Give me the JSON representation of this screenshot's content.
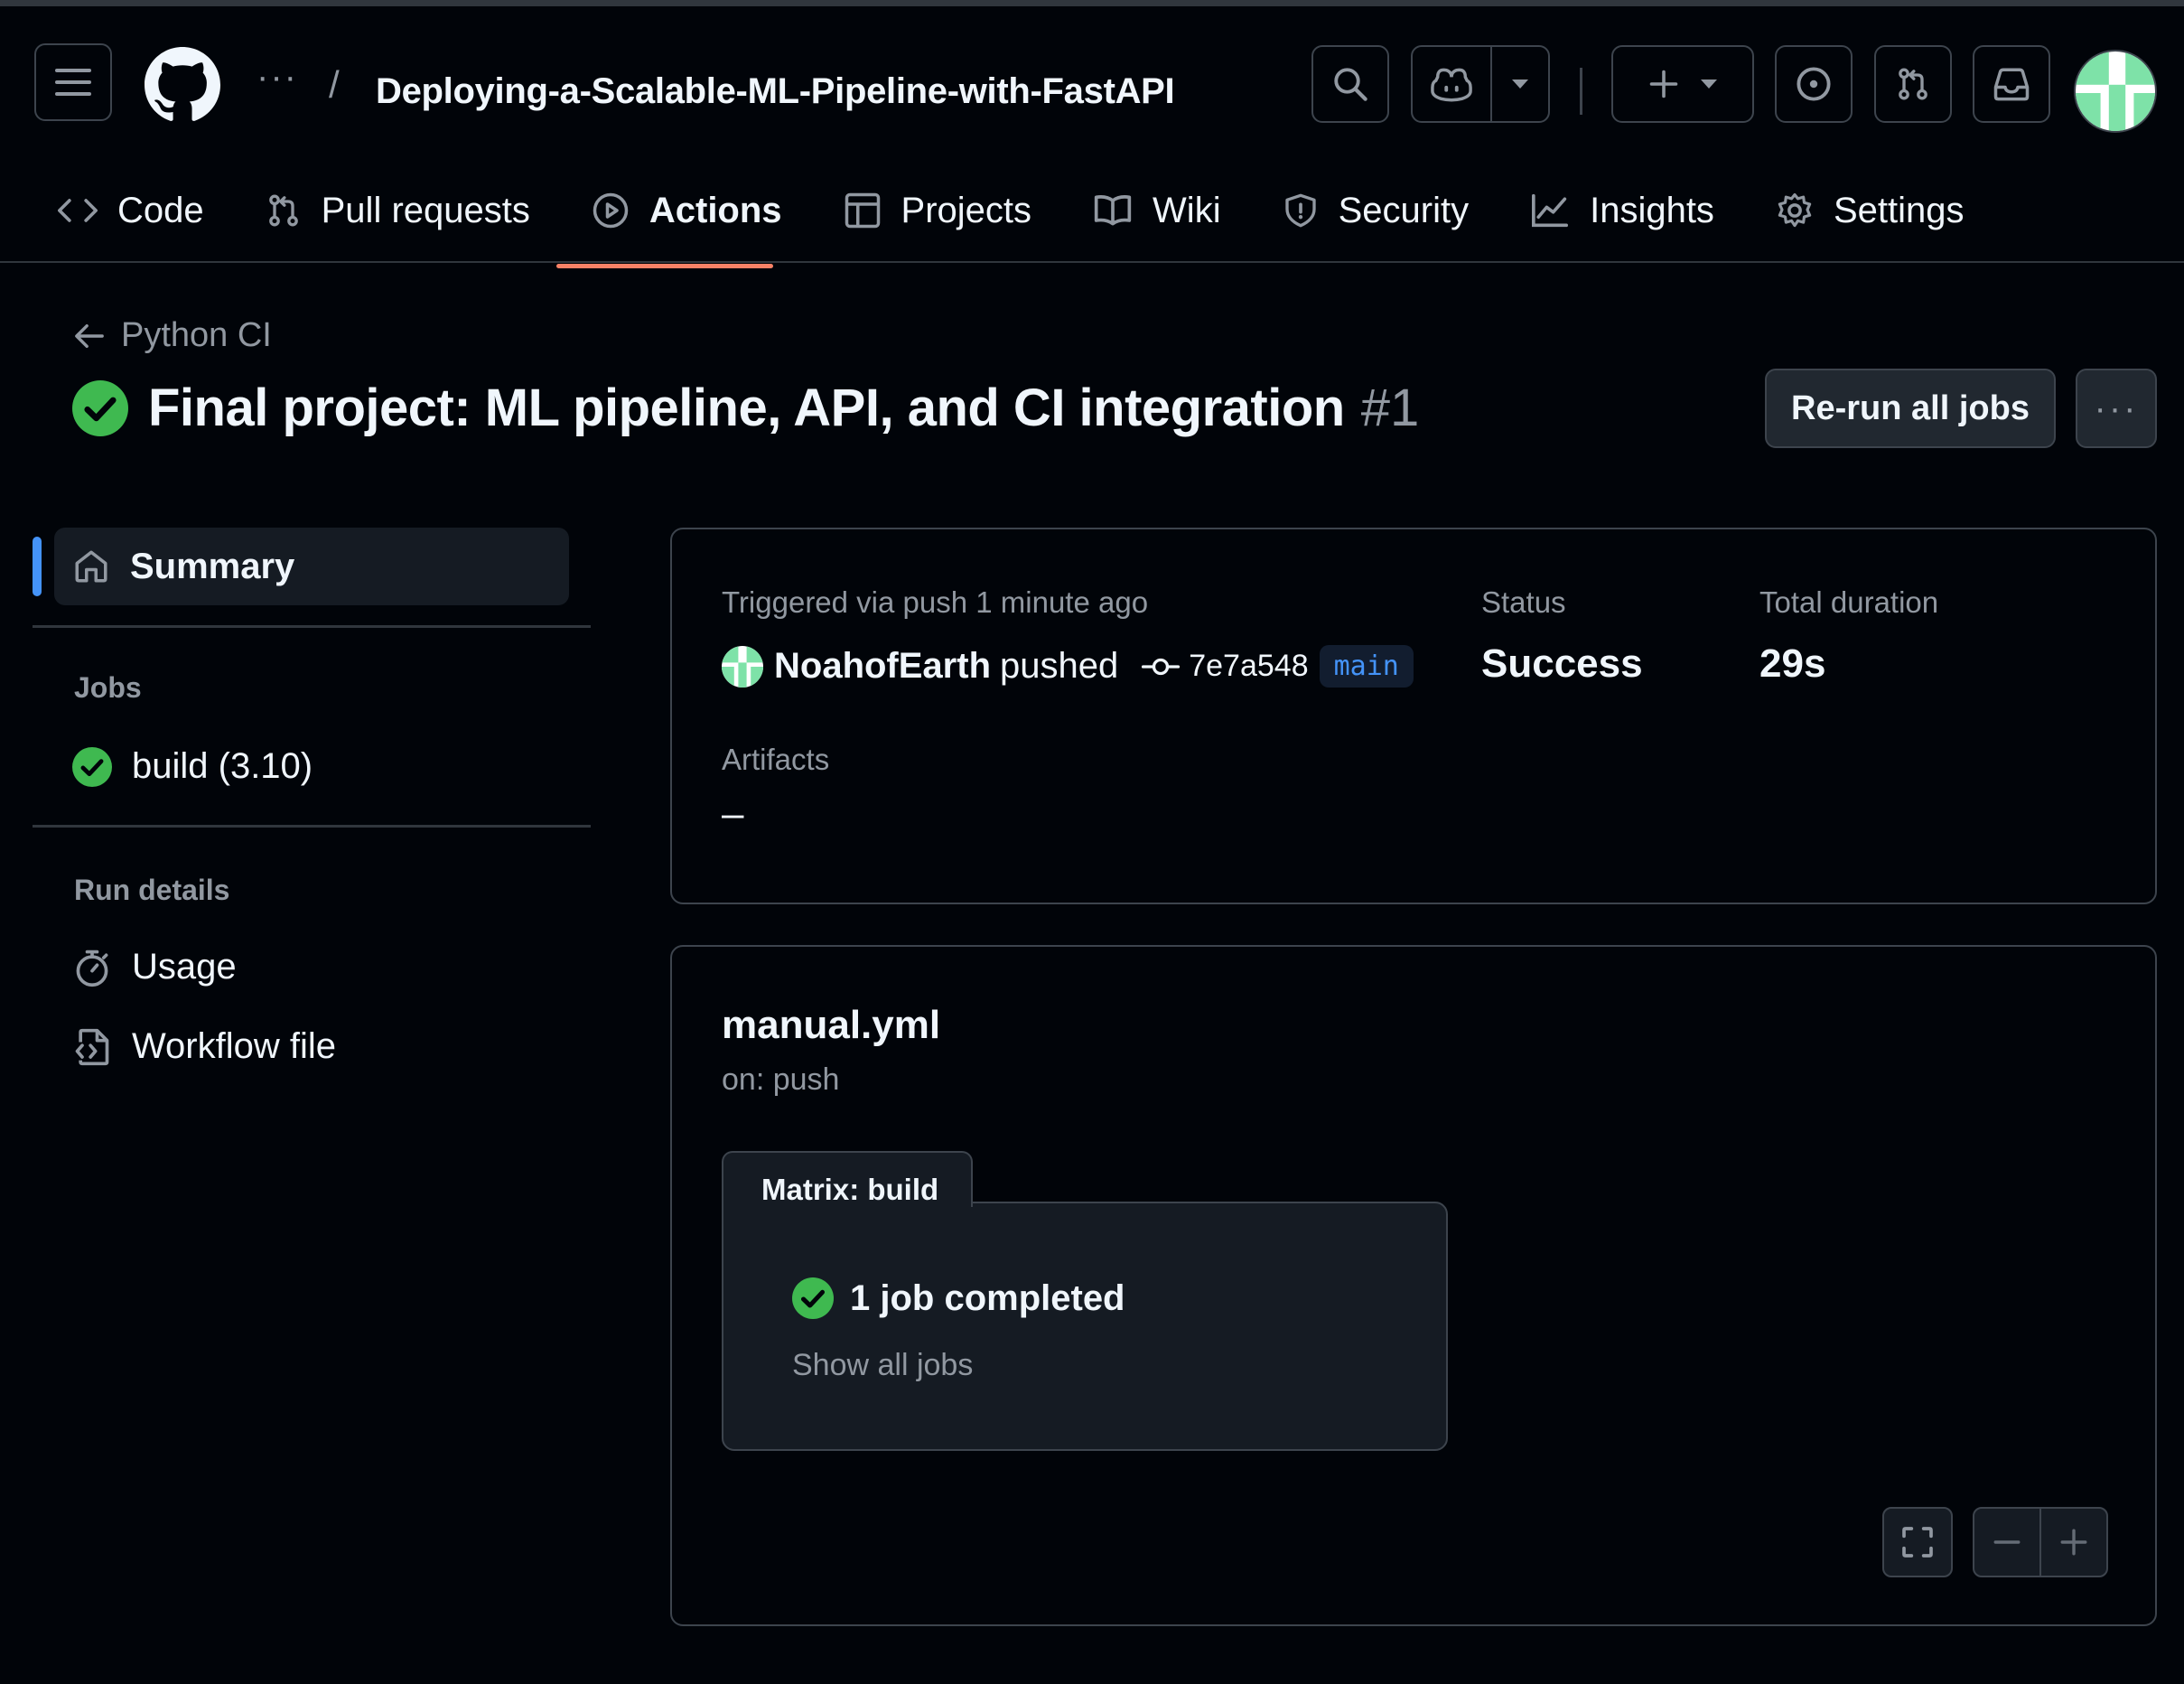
{
  "header": {
    "repo_name": "Deploying-a-Scalable-ML-Pipeline-with-FastAPI",
    "breadcrumb_more": "···",
    "breadcrumb_separator": "/"
  },
  "nav": {
    "tabs": [
      {
        "label": "Code",
        "icon": "code-icon"
      },
      {
        "label": "Pull requests",
        "icon": "pull-request-icon"
      },
      {
        "label": "Actions",
        "icon": "play-icon",
        "active": true
      },
      {
        "label": "Projects",
        "icon": "table-icon"
      },
      {
        "label": "Wiki",
        "icon": "book-icon"
      },
      {
        "label": "Security",
        "icon": "shield-icon"
      },
      {
        "label": "Insights",
        "icon": "graph-icon"
      },
      {
        "label": "Settings",
        "icon": "gear-icon"
      }
    ]
  },
  "run": {
    "back_label": "Python CI",
    "title": "Final project: ML pipeline, API, and CI integration",
    "number": "#1",
    "rerun_label": "Re-run all jobs",
    "more_label": "···"
  },
  "sidebar": {
    "summary_label": "Summary",
    "jobs_heading": "Jobs",
    "jobs": [
      {
        "label": "build (3.10)",
        "status": "success"
      }
    ],
    "run_details_heading": "Run details",
    "run_details": [
      {
        "label": "Usage",
        "icon": "stopwatch-icon"
      },
      {
        "label": "Workflow file",
        "icon": "file-code-icon"
      }
    ]
  },
  "summary": {
    "trigger_text": "Triggered via push 1 minute ago",
    "user": "NoahofEarth",
    "action": "pushed",
    "commit_sha": "7e7a548",
    "branch": "main",
    "status_label": "Status",
    "status_value": "Success",
    "duration_label": "Total duration",
    "duration_value": "29s",
    "artifacts_label": "Artifacts",
    "artifacts_value": "–"
  },
  "workflow": {
    "file_name": "manual.yml",
    "trigger": "on: push",
    "matrix_label": "Matrix: build",
    "matrix_status": "1 job completed",
    "show_all_label": "Show all jobs"
  },
  "colors": {
    "success": "#3fb950",
    "accent_underline": "#f78166",
    "link_blue": "#4493f8",
    "avatar_green": "#7ee2a8"
  }
}
